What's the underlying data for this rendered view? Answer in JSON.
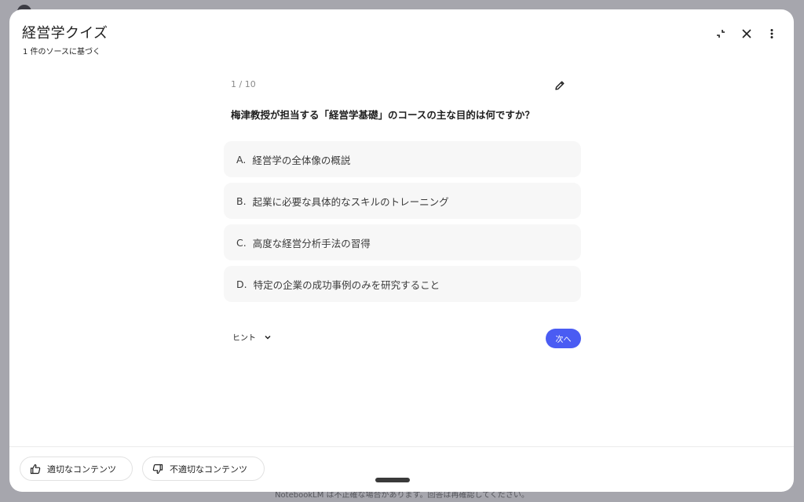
{
  "header": {
    "title": "経営学クイズ",
    "subtitle": "1 件のソースに基づく"
  },
  "quiz": {
    "counter": "1 / 10",
    "question": "梅津教授が担当する「経営学基礎」のコースの主な目的は何ですか？",
    "options": [
      {
        "letter": "A.",
        "text": "経営学の全体像の概説"
      },
      {
        "letter": "B.",
        "text": "起業に必要な具体的なスキルのトレーニング"
      },
      {
        "letter": "C.",
        "text": "高度な経営分析手法の習得"
      },
      {
        "letter": "D.",
        "text": "特定の企業の成功事例のみを研究すること"
      }
    ],
    "hint_label": "ヒント",
    "next_label": "次へ"
  },
  "feedback": {
    "good_label": "適切なコンテンツ",
    "bad_label": "不適切なコンテンツ"
  },
  "footer": {
    "note": "NotebookLM は不正確な場合があります。回答は再確認してください。"
  },
  "colors": {
    "accent": "#4a5cf3",
    "option_bg": "#f7f7f7",
    "backdrop": "#a6a6ad"
  }
}
